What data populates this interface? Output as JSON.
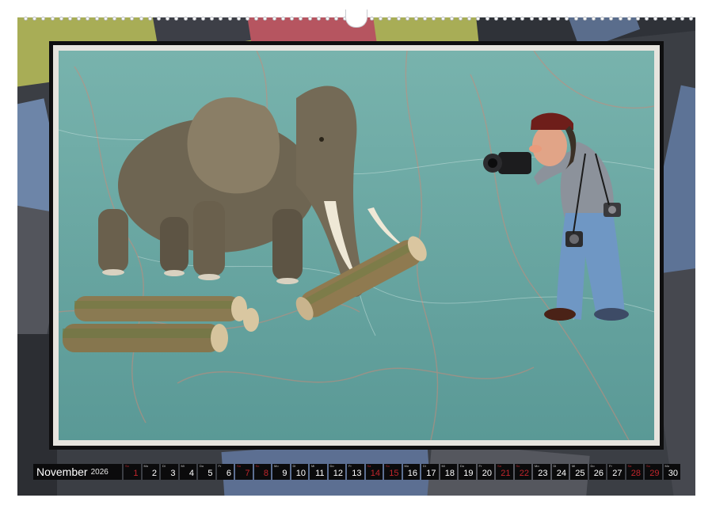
{
  "calendar": {
    "month": "November",
    "year": "2026",
    "days": [
      {
        "weekday": "So",
        "num": "1",
        "weekend": true
      },
      {
        "weekday": "Mo",
        "num": "2",
        "weekend": false
      },
      {
        "weekday": "Di",
        "num": "3",
        "weekend": false
      },
      {
        "weekday": "Mi",
        "num": "4",
        "weekend": false
      },
      {
        "weekday": "Do",
        "num": "5",
        "weekend": false
      },
      {
        "weekday": "Fr",
        "num": "6",
        "weekend": false
      },
      {
        "weekday": "Sa",
        "num": "7",
        "weekend": true
      },
      {
        "weekday": "So",
        "num": "8",
        "weekend": true
      },
      {
        "weekday": "Mo",
        "num": "9",
        "weekend": false
      },
      {
        "weekday": "Di",
        "num": "10",
        "weekend": false
      },
      {
        "weekday": "Mi",
        "num": "11",
        "weekend": false
      },
      {
        "weekday": "Do",
        "num": "12",
        "weekend": false
      },
      {
        "weekday": "Fr",
        "num": "13",
        "weekend": false
      },
      {
        "weekday": "Sa",
        "num": "14",
        "weekend": true
      },
      {
        "weekday": "So",
        "num": "15",
        "weekend": true
      },
      {
        "weekday": "Mo",
        "num": "16",
        "weekend": false
      },
      {
        "weekday": "Di",
        "num": "17",
        "weekend": false
      },
      {
        "weekday": "Mi",
        "num": "18",
        "weekend": false
      },
      {
        "weekday": "Do",
        "num": "19",
        "weekend": false
      },
      {
        "weekday": "Fr",
        "num": "20",
        "weekend": false
      },
      {
        "weekday": "Sa",
        "num": "21",
        "weekend": true
      },
      {
        "weekday": "So",
        "num": "22",
        "weekend": true
      },
      {
        "weekday": "Mo",
        "num": "23",
        "weekend": false
      },
      {
        "weekday": "Di",
        "num": "24",
        "weekend": false
      },
      {
        "weekday": "Mi",
        "num": "25",
        "weekend": false
      },
      {
        "weekday": "Do",
        "num": "26",
        "weekend": false
      },
      {
        "weekday": "Fr",
        "num": "27",
        "weekend": false
      },
      {
        "weekday": "Sa",
        "num": "28",
        "weekend": true
      },
      {
        "weekday": "So",
        "num": "29",
        "weekend": true
      },
      {
        "weekday": "Mo",
        "num": "30",
        "weekend": false
      }
    ]
  },
  "colors": {
    "weekend": "#c0262c",
    "strip_background": "#0b0b0c",
    "marble": "#6da9a6"
  },
  "photo": {
    "subjects": [
      "elephant-figure",
      "photographer-figure",
      "wood-logs"
    ]
  }
}
